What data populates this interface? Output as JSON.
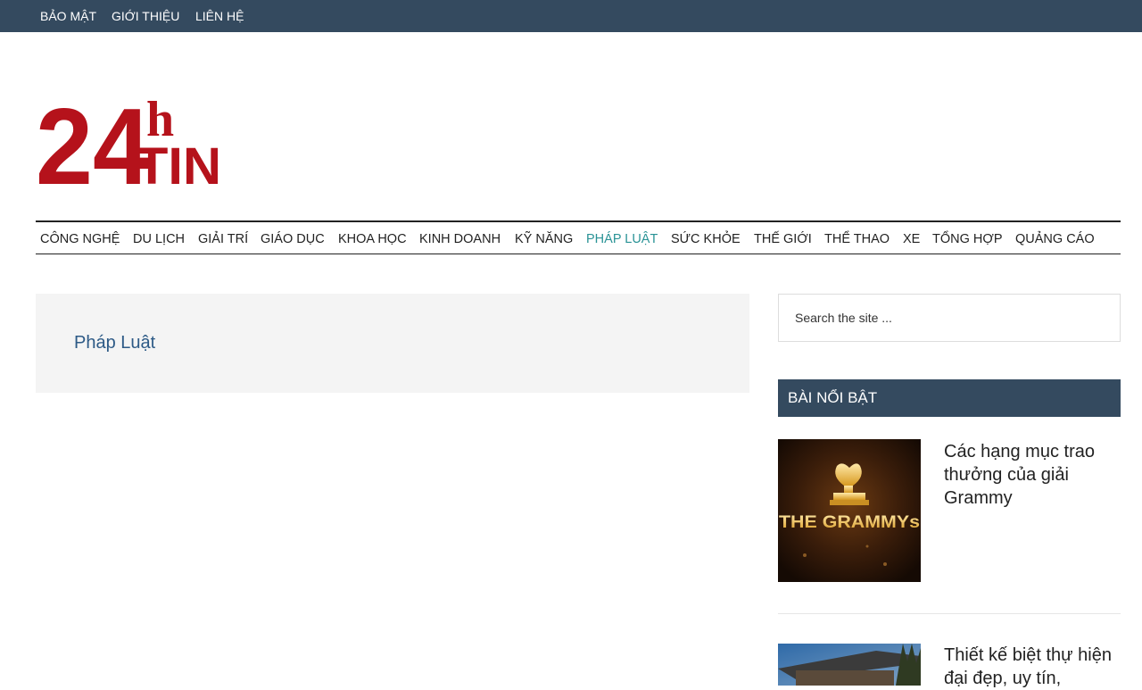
{
  "top_nav": {
    "items": [
      {
        "label": "BẢO MẬT"
      },
      {
        "label": "GIỚI THIỆU"
      },
      {
        "label": "LIÊN HỆ"
      }
    ]
  },
  "logo": {
    "text_top": "24",
    "text_h": "h",
    "text_tin": "TIN",
    "color": "#b5121b"
  },
  "main_nav": {
    "items": [
      {
        "label": "CÔNG NGHỆ"
      },
      {
        "label": "DU LỊCH"
      },
      {
        "label": "GIẢI TRÍ"
      },
      {
        "label": "GIÁO DỤC"
      },
      {
        "label": "KHOA HỌC"
      },
      {
        "label": "KINH DOANH"
      },
      {
        "label": "KỸ NĂNG"
      },
      {
        "label": "PHÁP LUẬT"
      },
      {
        "label": "SỨC KHỎE"
      },
      {
        "label": "THẾ GIỚI"
      },
      {
        "label": "THỂ THAO"
      },
      {
        "label": "XE"
      },
      {
        "label": "TỔNG HỢP"
      },
      {
        "label": "QUẢNG CÁO"
      }
    ],
    "active": "PHÁP LUẬT",
    "active_color": "#2a9396"
  },
  "archive": {
    "title": "Pháp Luật"
  },
  "sidebar": {
    "search": {
      "placeholder": "Search the site ..."
    },
    "featured": {
      "title": "BÀI NỔI BẬT",
      "posts": [
        {
          "title": "Các hạng mục trao thưởng của giải Grammy",
          "thumb_text": "THE GRAMMYs"
        },
        {
          "title": "Thiết kế biệt thự hiện đại đẹp, uy tín,"
        }
      ]
    }
  },
  "colors": {
    "bar": "#344a5f",
    "title_link": "#2d5a86"
  }
}
